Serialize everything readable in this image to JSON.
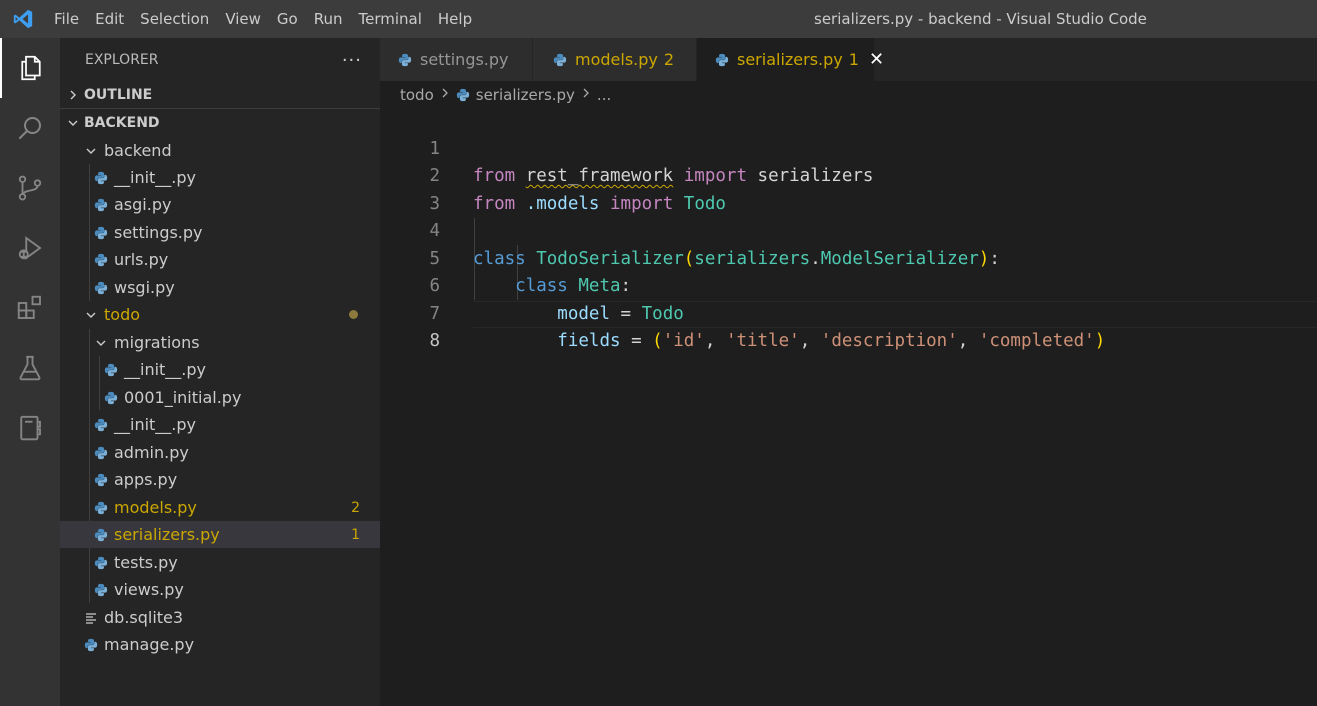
{
  "window": {
    "title": "serializers.py - backend - Visual Studio Code",
    "menu": [
      "File",
      "Edit",
      "Selection",
      "View",
      "Go",
      "Run",
      "Terminal",
      "Help"
    ]
  },
  "activitybar": {
    "items": [
      "files-icon",
      "search-icon",
      "source-control-icon",
      "run-debug-icon",
      "extensions-icon",
      "testing-icon",
      "notebook-icon"
    ]
  },
  "sidebar": {
    "header": "EXPLORER",
    "more": "···",
    "outline": "OUTLINE",
    "root": "BACKEND",
    "tree": [
      {
        "label": "backend",
        "type": "folder"
      },
      {
        "label": "__init__.py",
        "type": "file"
      },
      {
        "label": "asgi.py",
        "type": "file"
      },
      {
        "label": "settings.py",
        "type": "file"
      },
      {
        "label": "urls.py",
        "type": "file"
      },
      {
        "label": "wsgi.py",
        "type": "file"
      },
      {
        "label": "todo",
        "type": "folder"
      },
      {
        "label": "migrations",
        "type": "folder"
      },
      {
        "label": "__init__.py",
        "type": "file"
      },
      {
        "label": "0001_initial.py",
        "type": "file"
      },
      {
        "label": "__init__.py",
        "type": "file"
      },
      {
        "label": "admin.py",
        "type": "file"
      },
      {
        "label": "apps.py",
        "type": "file"
      },
      {
        "label": "models.py",
        "type": "file",
        "badge": "2"
      },
      {
        "label": "serializers.py",
        "type": "file",
        "badge": "1"
      },
      {
        "label": "tests.py",
        "type": "file"
      },
      {
        "label": "views.py",
        "type": "file"
      },
      {
        "label": "db.sqlite3",
        "type": "text"
      },
      {
        "label": "manage.py",
        "type": "file"
      }
    ]
  },
  "tabs": [
    {
      "label": "settings.py",
      "count": ""
    },
    {
      "label": "models.py",
      "count": "2"
    },
    {
      "label": "serializers.py",
      "count": "1",
      "close": "✕"
    }
  ],
  "breadcrumb": {
    "folder": "todo",
    "file": "serializers.py",
    "more": "..."
  },
  "code": {
    "line_numbers": [
      "1",
      "2",
      "3",
      "4",
      "5",
      "6",
      "7",
      "8"
    ],
    "l1": [
      "from",
      "rest_framework",
      "import",
      "serializers"
    ],
    "l2": [
      "from",
      ".models",
      "import",
      "Todo"
    ],
    "l4": [
      "class",
      "TodoSerializer",
      "(",
      "serializers",
      ".",
      "ModelSerializer",
      ")",
      ":"
    ],
    "l5": [
      "class",
      "Meta",
      ":"
    ],
    "l6": [
      "model",
      "=",
      "Todo"
    ],
    "l7": [
      "fields",
      "=",
      "(",
      "'id'",
      ", ",
      "'title'",
      ", ",
      "'description'",
      ", ",
      "'completed'",
      ")"
    ]
  },
  "colors": {
    "accent": "#007acc",
    "warning": "#cca700",
    "keyword": "#c586c0",
    "class": "#4ec9b0",
    "string": "#ce9178"
  }
}
